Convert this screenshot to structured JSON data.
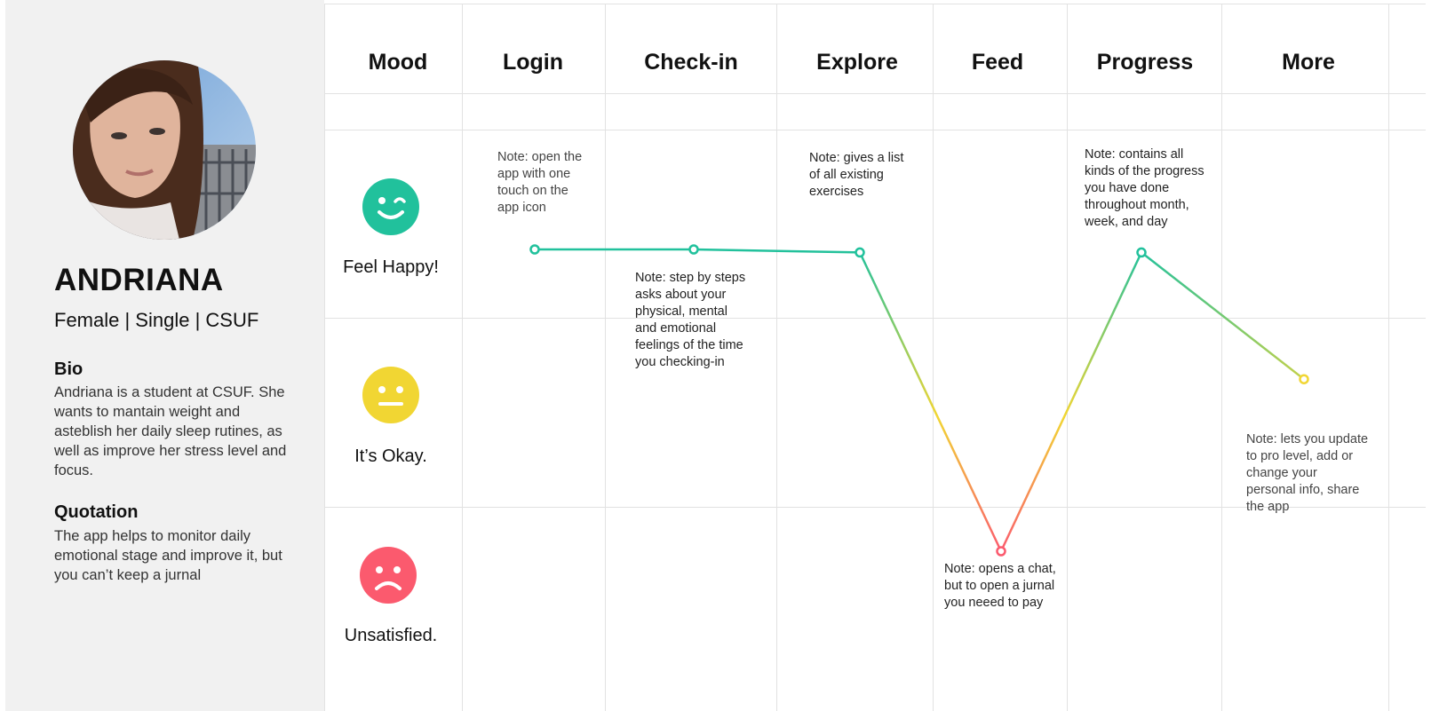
{
  "persona": {
    "name": "ANDRIANA",
    "meta": "Female | Single | CSUF",
    "bio_heading": "Bio",
    "bio_text": "Andriana is a student at CSUF. She wants to mantain weight and asteblish her daily sleep rutines, as well as improve her stress level and focus.",
    "quote_heading": "Quotation",
    "quote_text": "The app helps to monitor daily emotional stage  and improve it, but you can’t keep a jurnal"
  },
  "columns": [
    "Mood",
    "Login",
    "Check-in",
    "Explore",
    "Feed",
    "Progress",
    "More"
  ],
  "moods": [
    {
      "label": "Feel Happy!",
      "face": "happy-face-icon",
      "color": "#21c19c"
    },
    {
      "label": "It’s Okay.",
      "face": "neutral-face-icon",
      "color": "#f1d633"
    },
    {
      "label": "Unsatisfied.",
      "face": "sad-face-icon",
      "color": "#fb5a6e"
    }
  ],
  "notes": {
    "login": "Note: open the\napp with one\ntouch  on the\napp icon",
    "checkin": "Note: step by steps\nasks about your\nphysical, mental\nand emotional\nfeelings of the time\nyou checking-in",
    "explore": "Note: gives a list\nof all existing\nexercises",
    "feed": "Note: opens a chat,\nbut to open a jurnal\nyou neeed to pay",
    "progress": "Note: contains all\nkinds of the progress\nyou have done\nthroughout month,\nweek, and day",
    "more": "Note: lets you update\nto pro level, add or\nchange your\npersonal info, share\nthe app"
  },
  "journey": {
    "steps": [
      "Login",
      "Check-in",
      "Explore",
      "Feed",
      "Progress",
      "More"
    ],
    "mood_level": [
      1.0,
      1.0,
      0.99,
      0.0,
      0.99,
      0.57
    ],
    "colors": {
      "happy": "#21c19c",
      "neutral": "#f1d633",
      "unhappy": "#fb5a6e"
    }
  }
}
